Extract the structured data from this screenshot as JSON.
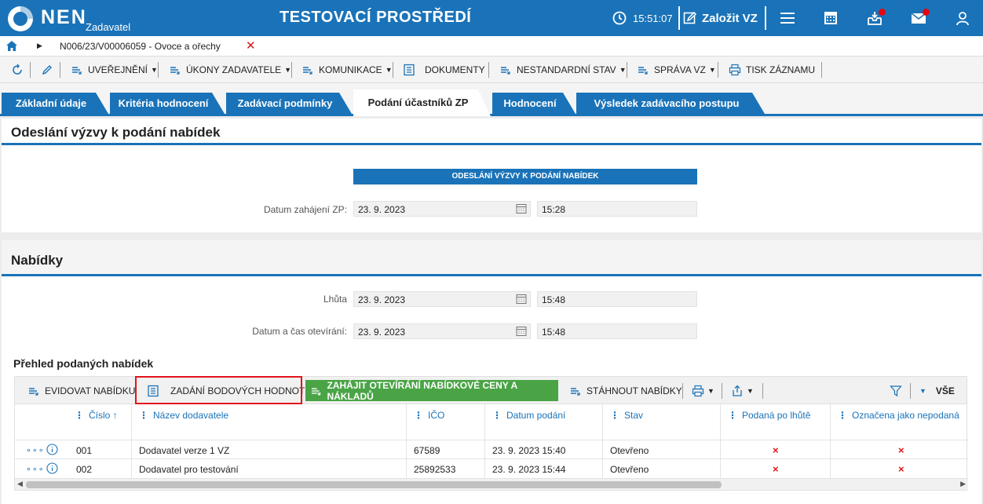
{
  "header": {
    "logo_text": "NEN",
    "logo_sub": "Zadavatel",
    "title": "TESTOVACÍ PROSTŘEDÍ",
    "time": "15:51:07",
    "create_label": "Založit VZ",
    "icons": [
      "clock-icon",
      "edit-icon",
      "menu-icon",
      "calendar-icon",
      "inbox-icon",
      "mail-icon",
      "user-icon"
    ]
  },
  "breadcrumb": {
    "path": "N006/23/V00006059 - Ovoce a ořechy"
  },
  "toolbar": {
    "uverejneni": "UVEŘEJNĚNÍ",
    "ukony": "ÚKONY ZADAVATELE",
    "komunikace": "KOMUNIKACE",
    "dokumenty": "DOKUMENTY",
    "nestandardni": "NESTANDARDNÍ STAV",
    "sprava": "SPRÁVA VZ",
    "tisk": "TISK ZÁZNAMU"
  },
  "tabs": [
    {
      "label": "Základní údaje"
    },
    {
      "label": "Kritéria hodnocení"
    },
    {
      "label": "Zadávací podmínky"
    },
    {
      "label": "Podání účastníků ZP"
    },
    {
      "label": "Hodnocení"
    },
    {
      "label": "Výsledek zadávacího postupu"
    }
  ],
  "section1": {
    "title": "Odeslání výzvy k podání nabídek",
    "bar": "ODESLÁNÍ VÝZVY K PODÁNÍ NABÍDEK",
    "start_label": "Datum zahájení ZP:",
    "start_date": "23. 9. 2023",
    "start_time": "15:28"
  },
  "section2": {
    "title": "Nabídky",
    "deadline_label": "Lhůta",
    "deadline_date": "23. 9. 2023",
    "deadline_time": "15:48",
    "open_label": "Datum a čas otevírání:",
    "open_date": "23. 9. 2023",
    "open_time": "15:48"
  },
  "offers": {
    "title": "Přehled podaných nabídek",
    "btn_evidovat": "EVIDOVAT NABÍDKU",
    "btn_zadani": "ZADÁNÍ BODOVÝCH HODNOT",
    "btn_zahajit": "ZAHÁJIT OTEVÍRÁNÍ NABÍDKOVÉ CENY A NÁKLADŮ",
    "btn_stahnout": "STÁHNOUT NABÍDKY",
    "filter_all": "VŠE",
    "columns": [
      "Číslo",
      "Název dodavatele",
      "IČO",
      "Datum podání",
      "Stav",
      "Podaná po lhůtě",
      "Označena jako nepodaná"
    ],
    "rows": [
      {
        "cislo": "001",
        "nazev": "Dodavatel verze 1 VZ",
        "ico": "67589",
        "datum": "23. 9. 2023 15:40",
        "stav": "Otevřeno",
        "po_lhute": "×",
        "nepodana": "×"
      },
      {
        "cislo": "002",
        "nazev": "Dodavatel pro testování",
        "ico": "25892533",
        "datum": "23. 9. 2023 15:44",
        "stav": "Otevřeno",
        "po_lhute": "×",
        "nepodana": "×"
      }
    ]
  },
  "colors": {
    "brand": "#1a73b8",
    "green": "#4aa446",
    "red": "#e2141b"
  }
}
